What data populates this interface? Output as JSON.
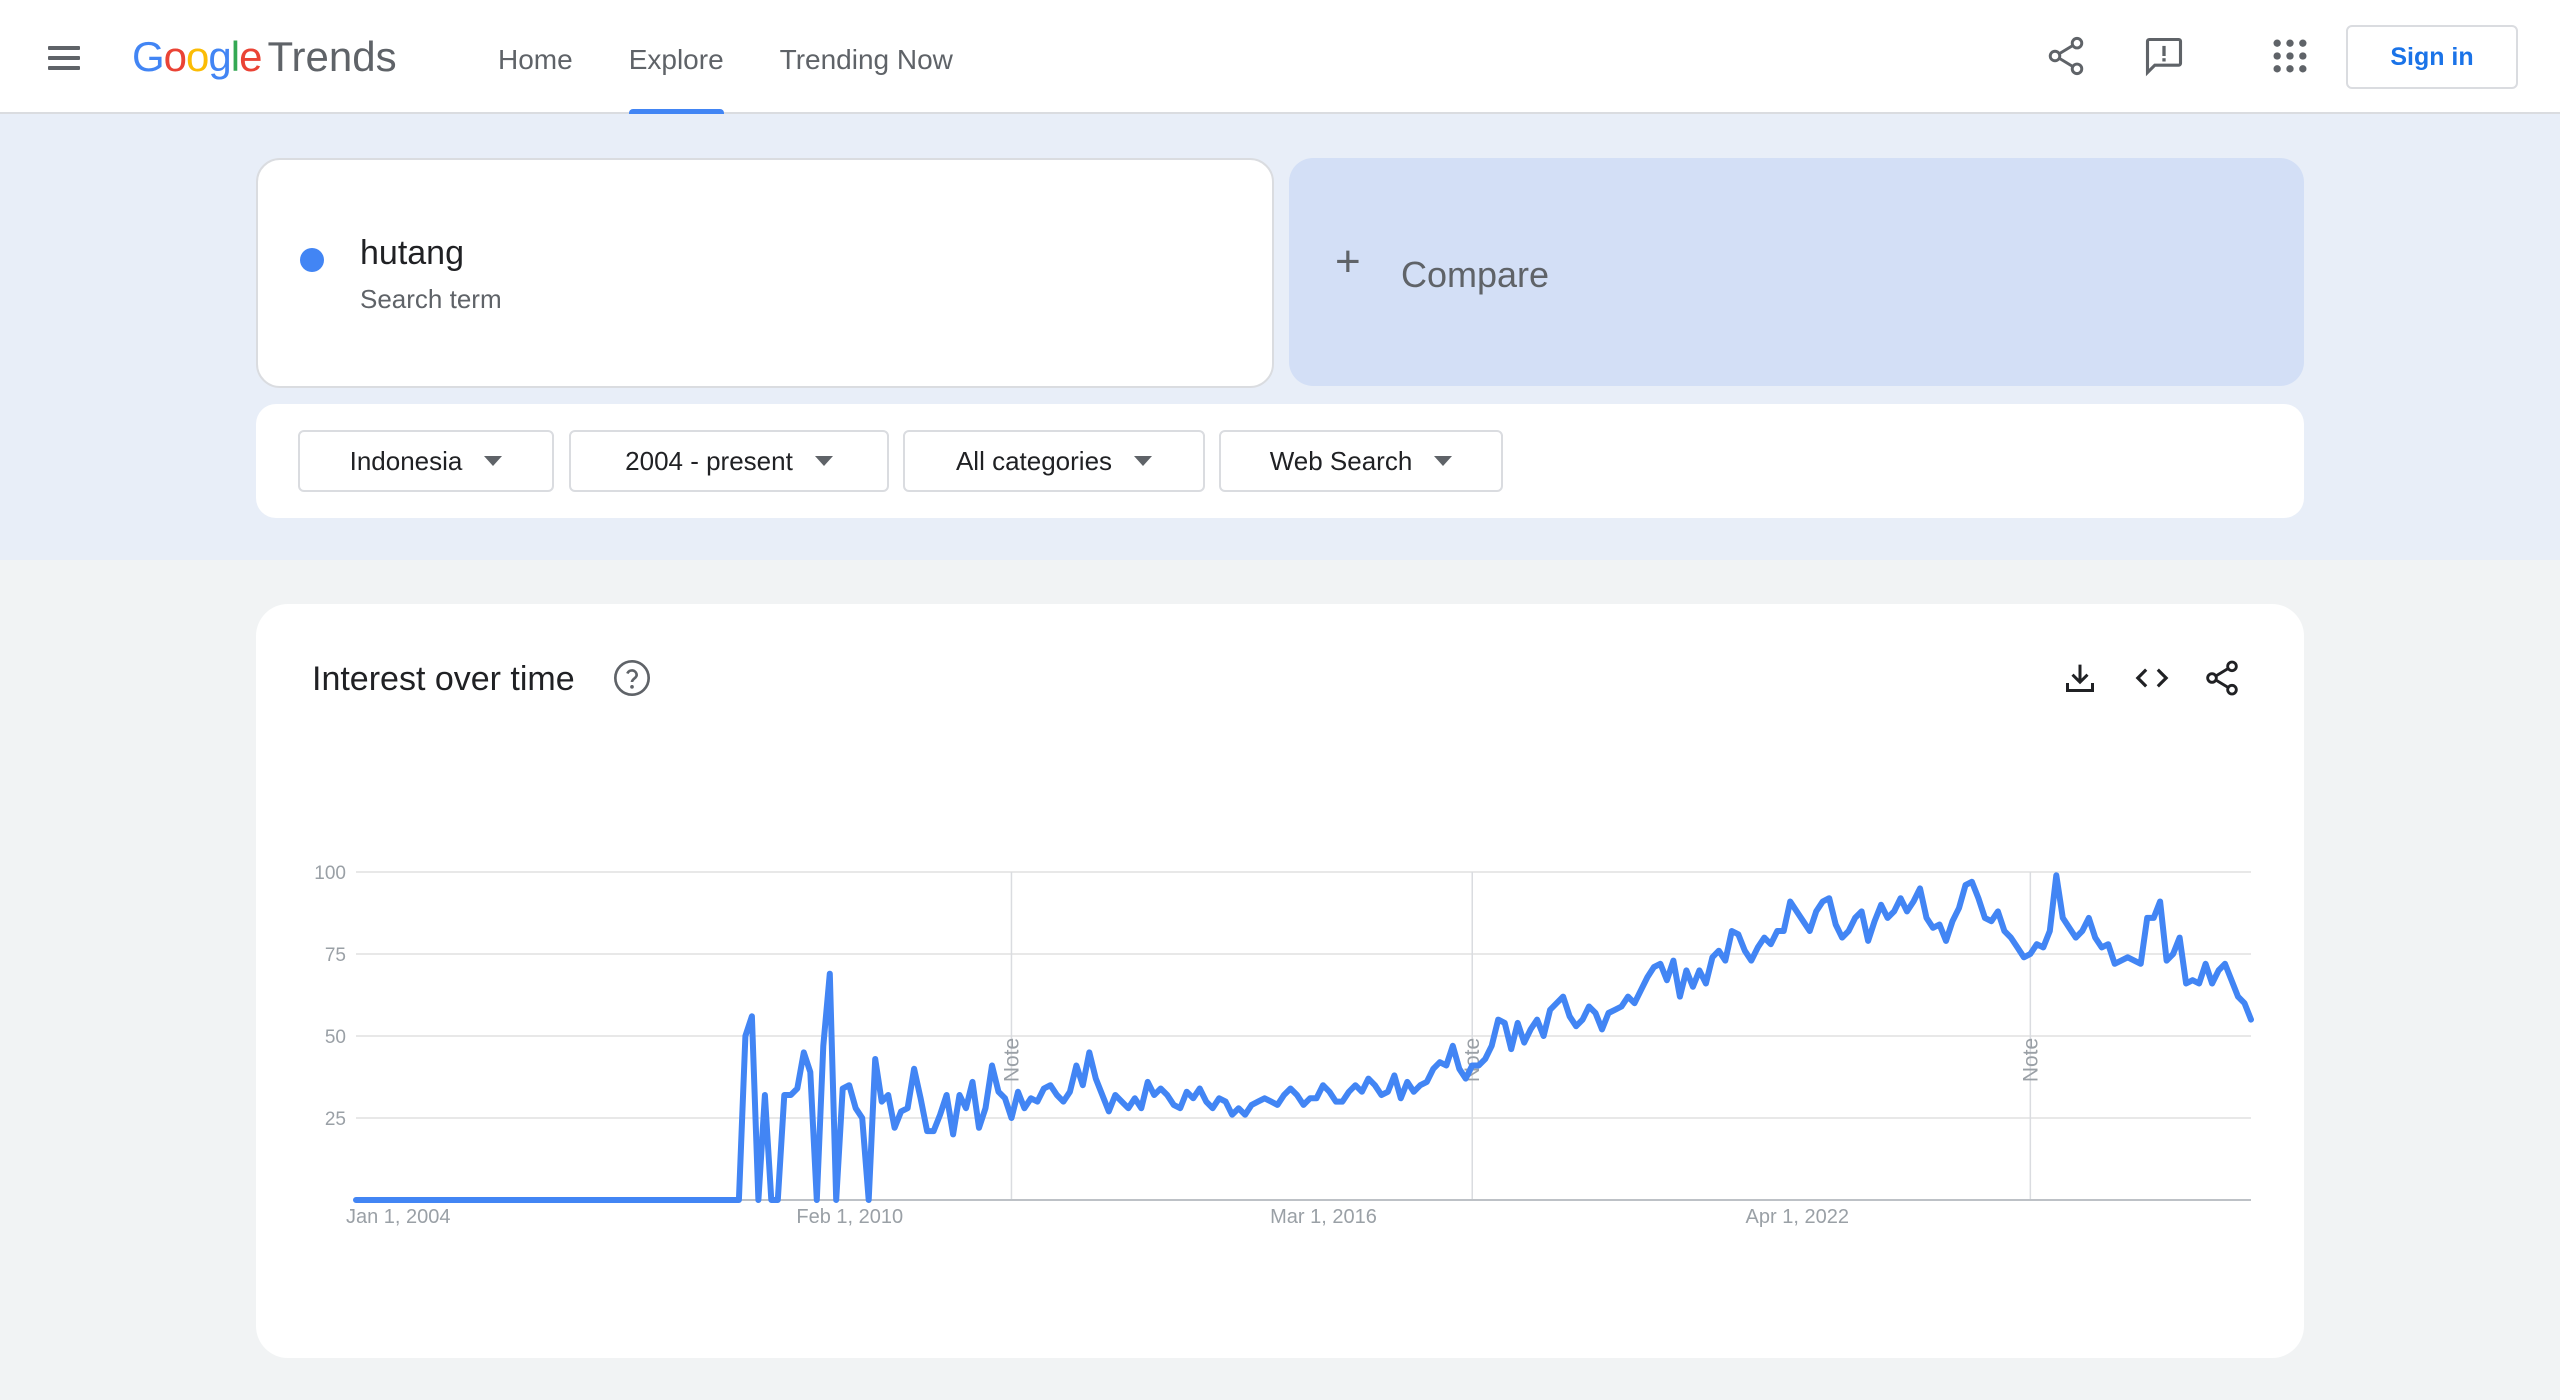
{
  "header": {
    "logo_google": [
      "G",
      "o",
      "o",
      "g",
      "l",
      "e"
    ],
    "logo_trends": "Trends",
    "nav": [
      "Home",
      "Explore",
      "Trending Now"
    ],
    "active_nav": "Explore",
    "sign_in": "Sign in",
    "icons": [
      "menu-icon",
      "share-icon",
      "feedback-icon",
      "apps-icon"
    ]
  },
  "search": {
    "term": "hutang",
    "term_type": "Search term",
    "term_color": "#4285f4",
    "compare_label": "Compare"
  },
  "filters": {
    "region": "Indonesia",
    "time": "2004 - present",
    "category": "All categories",
    "property": "Web Search"
  },
  "chart_card": {
    "title": "Interest over time",
    "icons": [
      "help-icon",
      "download-icon",
      "embed-icon",
      "share-icon"
    ]
  },
  "chart_data": {
    "type": "line",
    "title": "Interest over time",
    "y_ticks": [
      "100",
      "75",
      "50",
      "25"
    ],
    "ylim": [
      0,
      100
    ],
    "x_labels": [
      "Jan 1, 2004",
      "Feb 1, 2010",
      "Mar 1, 2016",
      "Apr 1, 2022"
    ],
    "notes": [
      "Note",
      "Note",
      "Note"
    ],
    "grid": true,
    "series": [
      {
        "color": "#4285f4",
        "start": "2004-01",
        "frequency": "monthly",
        "values": [
          0,
          0,
          0,
          0,
          0,
          0,
          0,
          0,
          0,
          0,
          0,
          0,
          0,
          0,
          0,
          0,
          0,
          0,
          0,
          0,
          0,
          0,
          0,
          0,
          0,
          0,
          0,
          0,
          0,
          0,
          0,
          0,
          0,
          0,
          0,
          0,
          0,
          0,
          0,
          0,
          0,
          0,
          0,
          0,
          0,
          0,
          0,
          0,
          0,
          0,
          0,
          0,
          0,
          0,
          0,
          0,
          0,
          0,
          0,
          0,
          50,
          56,
          0,
          32,
          0,
          0,
          32,
          32,
          34,
          45,
          39,
          0,
          47,
          69,
          0,
          34,
          35,
          28,
          25,
          0,
          43,
          30,
          32,
          22,
          27,
          28,
          40,
          31,
          21,
          21,
          26,
          32,
          20,
          32,
          28,
          36,
          22,
          28,
          41,
          33,
          31,
          25,
          33,
          28,
          31,
          30,
          34,
          35,
          32,
          30,
          33,
          41,
          35,
          45,
          37,
          32,
          27,
          32,
          30,
          28,
          31,
          28,
          36,
          32,
          34,
          32,
          29,
          28,
          33,
          31,
          34,
          30,
          28,
          31,
          30,
          26,
          28,
          26,
          29,
          30,
          31,
          30,
          29,
          32,
          34,
          32,
          29,
          31,
          31,
          35,
          33,
          30,
          30,
          33,
          35,
          33,
          37,
          35,
          32,
          33,
          38,
          31,
          36,
          33,
          35,
          36,
          40,
          42,
          41,
          47,
          40,
          37,
          41,
          41,
          43,
          47,
          55,
          54,
          46,
          54,
          48,
          52,
          55,
          50,
          58,
          60,
          62,
          56,
          53,
          55,
          59,
          57,
          52,
          57,
          58,
          59,
          62,
          60,
          64,
          68,
          71,
          72,
          67,
          73,
          62,
          70,
          65,
          70,
          66,
          74,
          76,
          73,
          82,
          81,
          76,
          73,
          77,
          80,
          78,
          82,
          82,
          91,
          88,
          85,
          82,
          88,
          91,
          92,
          84,
          80,
          82,
          86,
          88,
          79,
          85,
          90,
          86,
          88,
          92,
          88,
          91,
          95,
          86,
          83,
          84,
          79,
          85,
          89,
          96,
          97,
          92,
          86,
          85,
          88,
          82,
          80,
          77,
          74,
          75,
          78,
          77,
          82,
          99,
          86,
          83,
          80,
          82,
          86,
          80,
          77,
          78,
          72,
          73,
          74,
          73,
          72,
          86,
          86,
          91,
          73,
          75,
          80,
          66,
          67,
          66,
          72,
          66,
          70,
          72,
          67,
          62,
          60,
          55
        ]
      }
    ]
  }
}
